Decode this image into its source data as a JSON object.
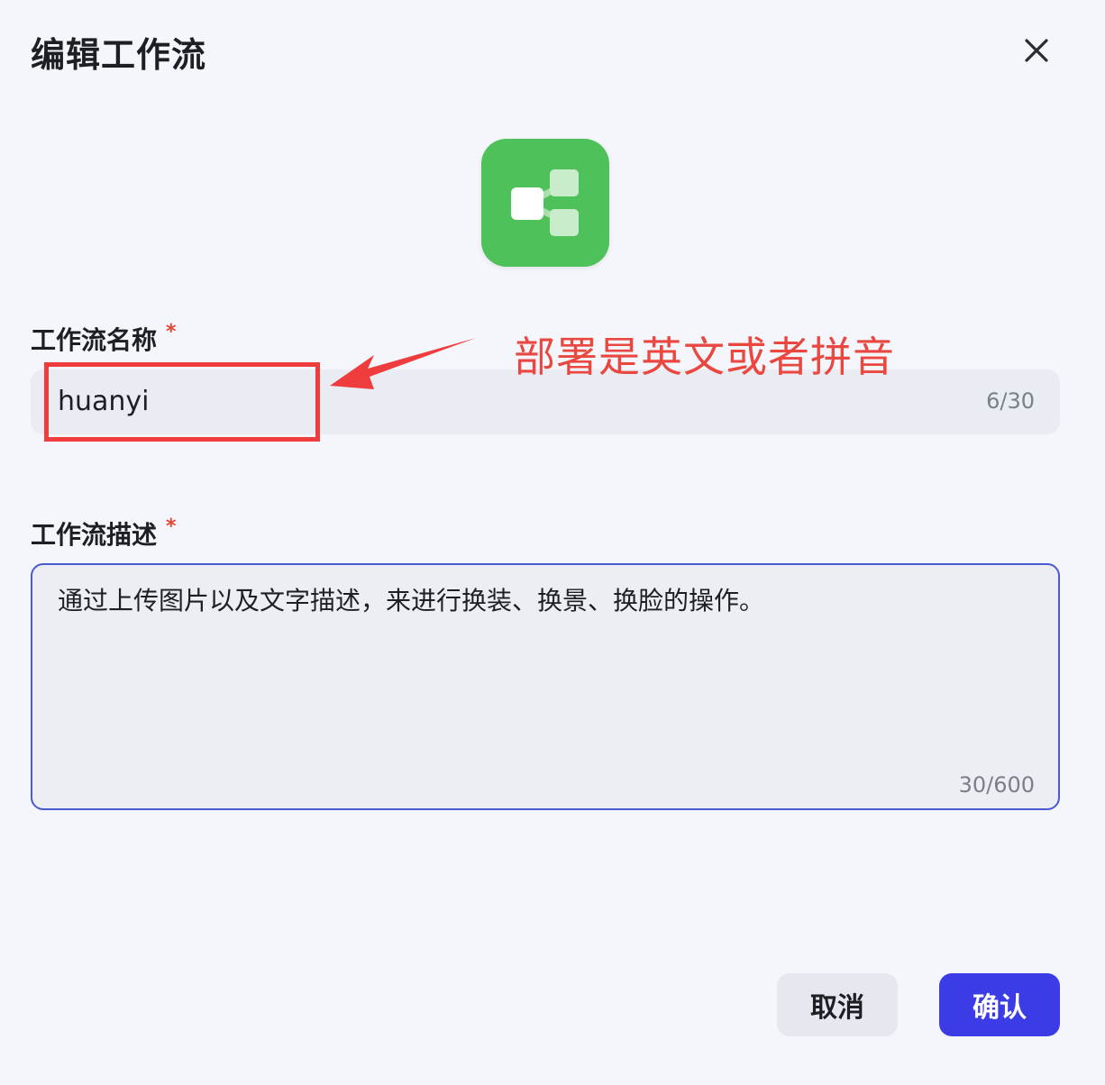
{
  "dialog": {
    "title": "编辑工作流",
    "close_icon": "close-icon",
    "app_icon": "workflow-icon",
    "accent_green": "#4fc15a"
  },
  "form": {
    "name_label": "工作流名称",
    "name_required": "*",
    "name_value": "huanyi",
    "name_counter": "6/30",
    "desc_label": "工作流描述",
    "desc_required": "*",
    "desc_value": "通过上传图片以及文字描述，来进行换装、换景、换脸的操作。",
    "desc_counter": "30/600"
  },
  "annotation": {
    "text": "部署是英文或者拼音",
    "color": "#e9473f"
  },
  "buttons": {
    "cancel_label": "取消",
    "confirm_label": "确认",
    "confirm_color": "#3c3ce6"
  }
}
